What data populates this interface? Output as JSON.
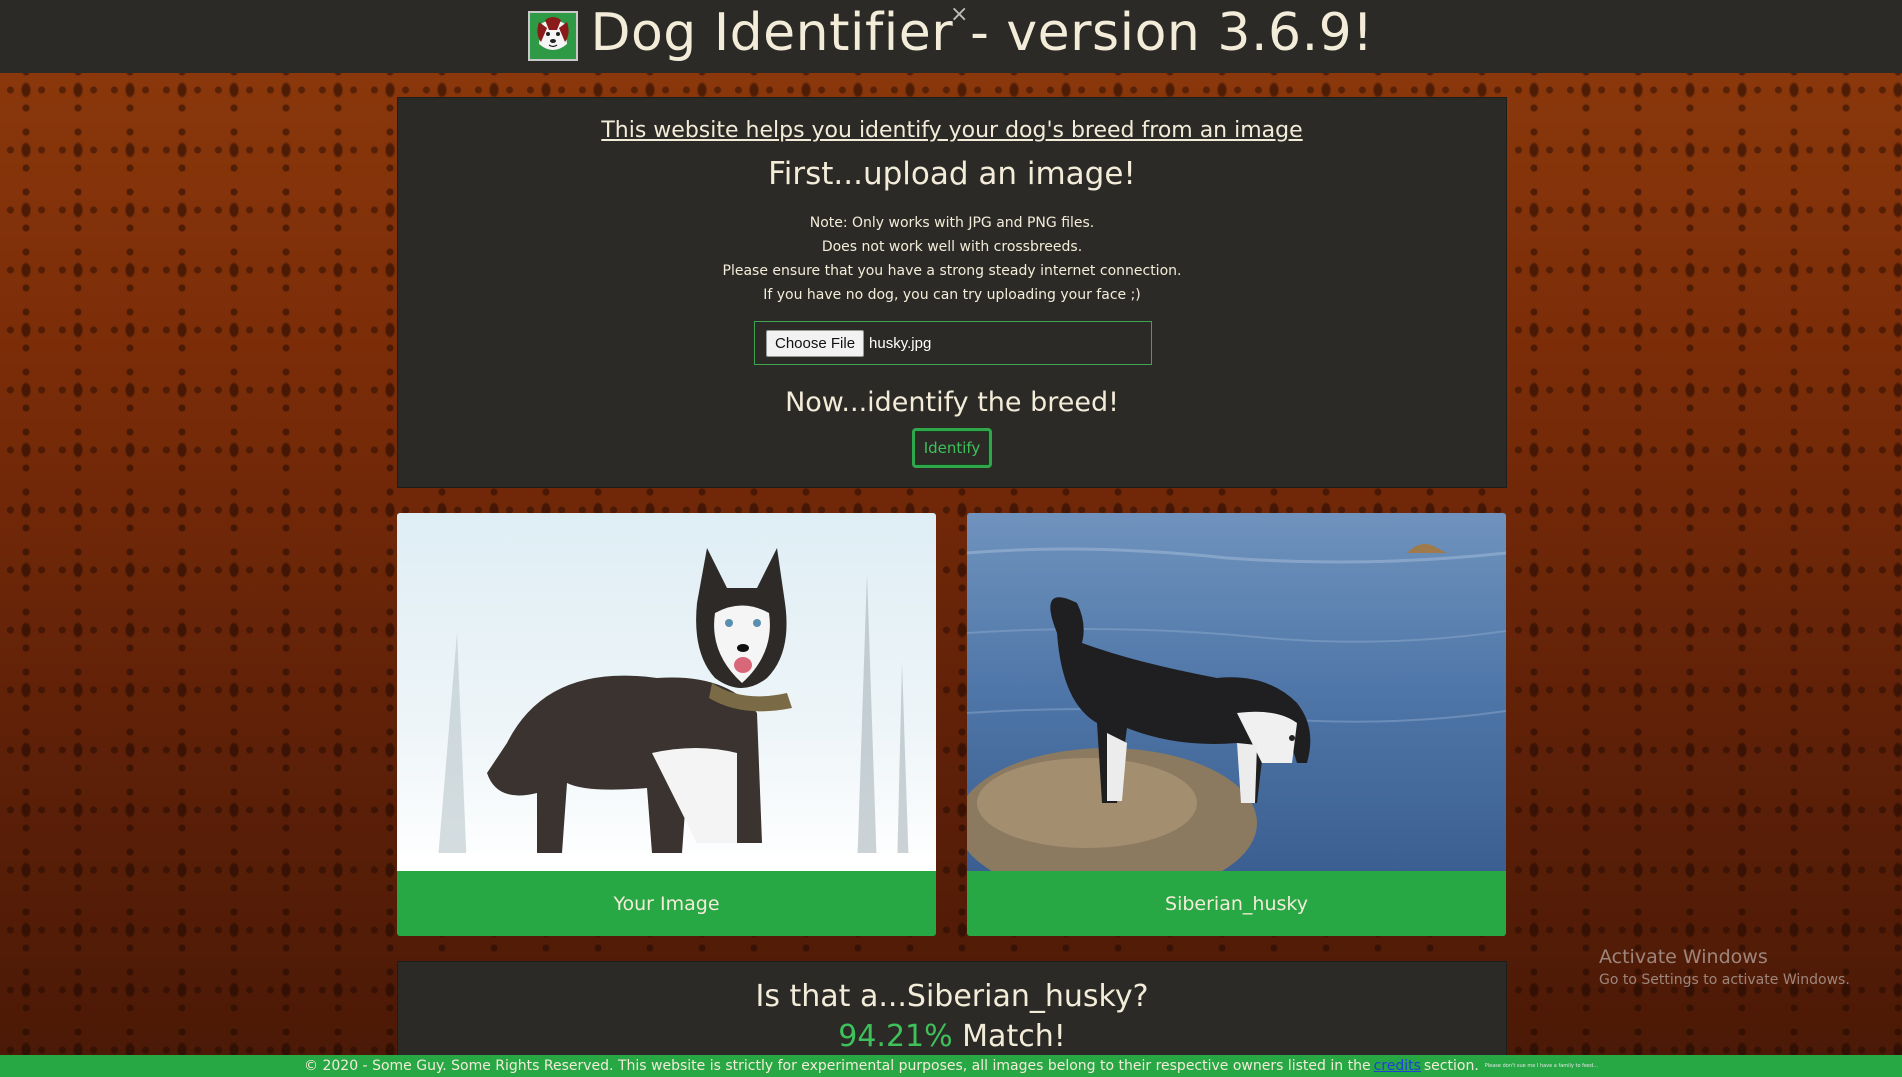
{
  "header": {
    "title": "Dog Identifier - version 3.6.9!",
    "close_glyph": "×"
  },
  "upload_panel": {
    "intro_link": "This website helps you identify your dog's breed from an image",
    "heading": "First...upload an image!",
    "notes": [
      "Note: Only works with JPG and PNG files.",
      "Does not work well with crossbreeds.",
      "Please ensure that you have a strong steady internet connection.",
      "If you have no dog, you can try uploading your face ;)"
    ],
    "choose_file_label": "Choose File",
    "file_name": "husky.jpg",
    "identify_heading": "Now...identify the breed!",
    "identify_button": "Identify"
  },
  "cards": {
    "left_label": "Your Image",
    "right_label": "Siberian_husky"
  },
  "result": {
    "question": "Is that a...Siberian_husky?",
    "percent": "94.21%",
    "match_word": "Match!"
  },
  "watermark": {
    "line1": "Activate Windows",
    "line2": "Go to Settings to activate Windows."
  },
  "footer": {
    "text_before": "© 2020 - Some Guy. Some Rights Reserved. This website is strictly for experimental purposes, all images belong to their respective owners listed in the",
    "link": "credits",
    "text_after": "section.",
    "tiny_note": "Please don't sue me I have a family to feed..."
  },
  "colors": {
    "accent_green": "#28a745",
    "panel_bg": "#2b2a26",
    "text_cream": "#f3ecd9"
  }
}
